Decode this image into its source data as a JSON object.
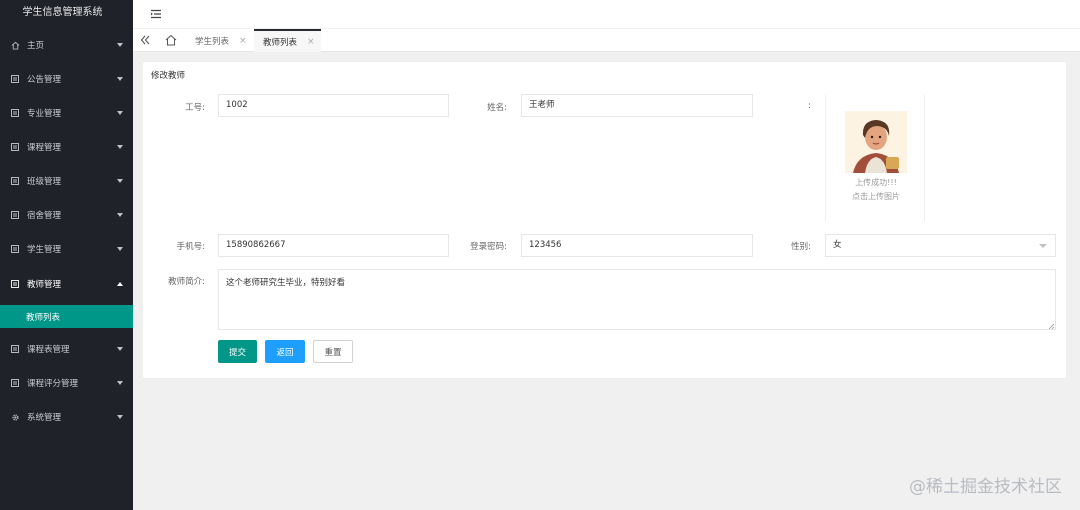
{
  "app": {
    "title": "学生信息管理系统"
  },
  "sidebar": {
    "items": [
      {
        "label": "主页",
        "icon": "home-icon"
      },
      {
        "label": "公告管理",
        "icon": "doc-icon"
      },
      {
        "label": "专业管理",
        "icon": "doc-icon"
      },
      {
        "label": "课程管理",
        "icon": "doc-icon"
      },
      {
        "label": "班级管理",
        "icon": "doc-icon"
      },
      {
        "label": "宿舍管理",
        "icon": "doc-icon"
      },
      {
        "label": "学生管理",
        "icon": "doc-icon"
      },
      {
        "label": "教师管理",
        "icon": "doc-icon",
        "expanded": true
      },
      {
        "label": "课程表管理",
        "icon": "doc-icon"
      },
      {
        "label": "课程评分管理",
        "icon": "doc-icon"
      },
      {
        "label": "系统管理",
        "icon": "gear-icon"
      }
    ],
    "active_sub": "教师列表"
  },
  "tabs": [
    {
      "label": "学生列表",
      "close": "×"
    },
    {
      "label": "教师列表",
      "close": "×",
      "active": true
    }
  ],
  "form": {
    "title": "修改教师",
    "job_no_label": "工号:",
    "job_no_value": "1002",
    "name_label": "姓名:",
    "name_value": "王老师",
    "photo_label": ":",
    "upload_success": "上传成功!!!",
    "upload_hint": "点击上传图片",
    "phone_label": "手机号:",
    "phone_value": "15890862667",
    "password_label": "登录密码:",
    "password_value": "123456",
    "gender_label": "性别:",
    "gender_value": "女",
    "intro_label": "教师简介:",
    "intro_value": "这个老师研究生毕业，特别好看",
    "submit": "提交",
    "back": "返回",
    "reset": "重置"
  },
  "colors": {
    "sidebar_bg": "#20222a",
    "accent_green": "#009688",
    "accent_blue": "#1e9fff"
  },
  "watermark": "@稀土掘金技术社区"
}
